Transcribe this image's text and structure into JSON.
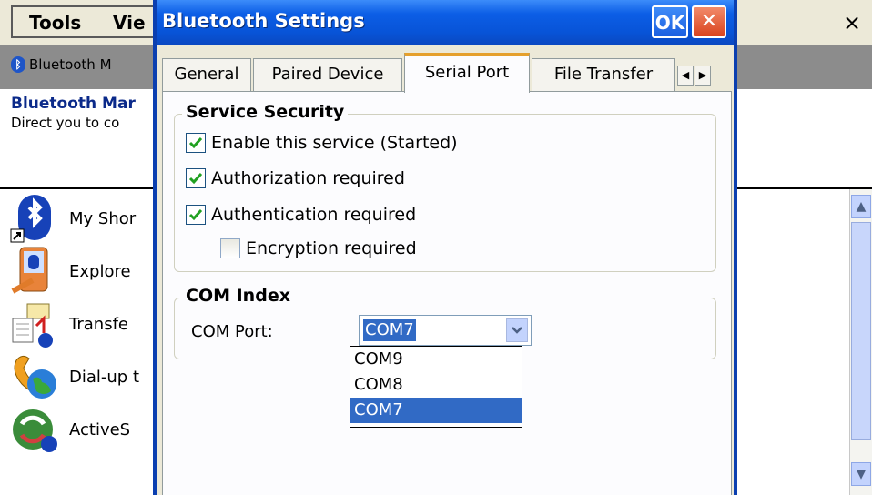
{
  "app": {
    "menu": [
      "Tools",
      "Vie"
    ],
    "close_glyph": "×",
    "tab_label": "Bluetooth M",
    "page_title": "Bluetooth Mar",
    "page_desc": "Direct you to co",
    "list_items": [
      {
        "label": "My Shor",
        "icon": "bluetooth-shortcut-icon"
      },
      {
        "label": "Explore",
        "icon": "pda-bluetooth-icon"
      },
      {
        "label": "Transfe",
        "icon": "file-transfer-icon"
      },
      {
        "label": "Dial-up t",
        "icon": "dialup-globe-icon"
      },
      {
        "label": "ActiveS",
        "icon": "activesync-icon"
      }
    ]
  },
  "dialog": {
    "title": "Bluetooth Settings",
    "ok_label": "OK",
    "close_glyph": "✕",
    "tabs": [
      {
        "label": "General",
        "active": false
      },
      {
        "label": "Paired Device",
        "active": false
      },
      {
        "label": "Serial Port",
        "active": true
      },
      {
        "label": "File Transfer",
        "active": false
      }
    ],
    "service_security": {
      "legend": "Service Security",
      "options": [
        {
          "label": "Enable this service (Started)",
          "checked": true
        },
        {
          "label": "Authorization required",
          "checked": true
        },
        {
          "label": "Authentication required",
          "checked": true
        },
        {
          "label": "Encryption required",
          "checked": false
        }
      ]
    },
    "com_index": {
      "legend": "COM Index",
      "port_label": "COM Port:",
      "selected": "COM7",
      "options": [
        "COM9",
        "COM8",
        "COM7"
      ]
    }
  },
  "colors": {
    "title_blue": "#0c5ee6",
    "selection_blue": "#316ac5",
    "check_green": "#21a121",
    "active_tab_accent": "#e5a02d",
    "dialog_face": "#ece9d8"
  }
}
